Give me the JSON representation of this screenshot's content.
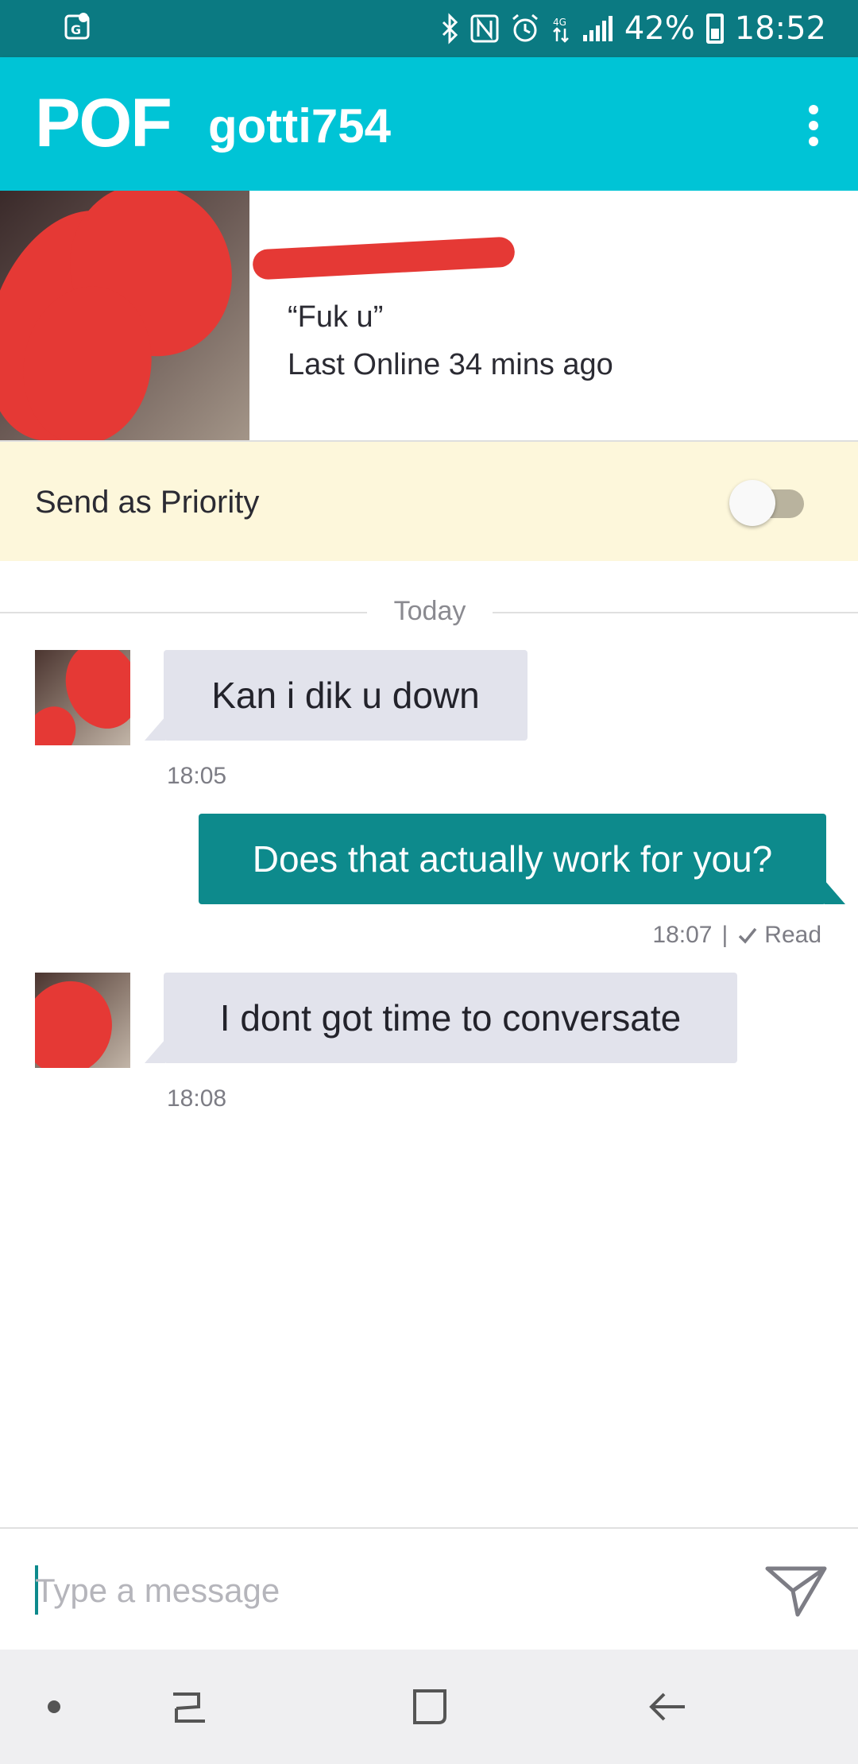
{
  "status_bar": {
    "battery": "42%",
    "time": "18:52",
    "lte_label": "4G"
  },
  "app_bar": {
    "logo": "POF",
    "username": "gotti754"
  },
  "profile": {
    "tagline": "“Fuk u”",
    "last_online": "Last Online 34 mins ago"
  },
  "priority": {
    "label": "Send as Priority",
    "enabled": false
  },
  "chat": {
    "day_label": "Today",
    "messages": [
      {
        "direction": "incoming",
        "text": "Kan i dik u down",
        "time": "18:05"
      },
      {
        "direction": "outgoing",
        "text": "Does that actually work for you?",
        "time": "18:07",
        "separator": "|",
        "status": "Read"
      },
      {
        "direction": "incoming",
        "text": "I dont got time to conversate",
        "time": "18:08"
      }
    ]
  },
  "composer": {
    "placeholder": "Type a message"
  },
  "colors": {
    "status_bar": "#0b7a82",
    "app_bar": "#00c4d6",
    "priority_bg": "#fdf7db",
    "outgoing_bubble": "#0d8a8c",
    "incoming_bubble": "#e2e3ec",
    "redaction": "#e53935"
  },
  "icons": {
    "status_left": "map-location-icon",
    "bluetooth": "bluetooth-icon",
    "nfc": "nfc-icon",
    "alarm": "alarm-icon",
    "data": "mobile-data-icon",
    "signal": "signal-icon",
    "battery": "battery-icon",
    "menu": "more-vert-icon",
    "send": "send-icon",
    "nav": [
      "nav-dot-icon",
      "recent-apps-icon",
      "home-icon",
      "back-icon"
    ]
  }
}
